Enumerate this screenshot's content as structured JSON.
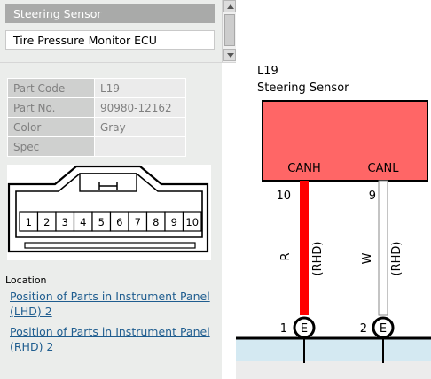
{
  "list": {
    "items": [
      {
        "label": "Steering Sensor",
        "selected": true
      },
      {
        "label": "Tire Pressure Monitor ECU",
        "selected": false
      }
    ]
  },
  "part_table": {
    "rows": [
      {
        "key": "Part Code",
        "value": "L19"
      },
      {
        "key": "Part No.",
        "value": "90980-12162"
      },
      {
        "key": "Color",
        "value": "Gray"
      },
      {
        "key": "Spec",
        "value": ""
      }
    ]
  },
  "connector": {
    "pins": [
      "1",
      "2",
      "3",
      "4",
      "5",
      "6",
      "7",
      "8",
      "9",
      "10"
    ]
  },
  "location": {
    "label": "Location",
    "links": [
      "Position of Parts in Instrument Panel (LHD) 2",
      "Position of Parts in Instrument Panel (RHD) 2"
    ]
  },
  "diagram": {
    "code": "L19",
    "name": "Steering Sensor",
    "box_color": "#ff6666",
    "pins": [
      {
        "signal": "CANH",
        "pin": "10",
        "wire_color": "R",
        "note": "(RHD)",
        "ground_pin": "1",
        "ground_label": "E",
        "color": "#ff0000"
      },
      {
        "signal": "CANL",
        "pin": "9",
        "wire_color": "W",
        "note": "(RHD)",
        "ground_pin": "2",
        "ground_label": "E",
        "color": "#ffffff"
      }
    ]
  }
}
